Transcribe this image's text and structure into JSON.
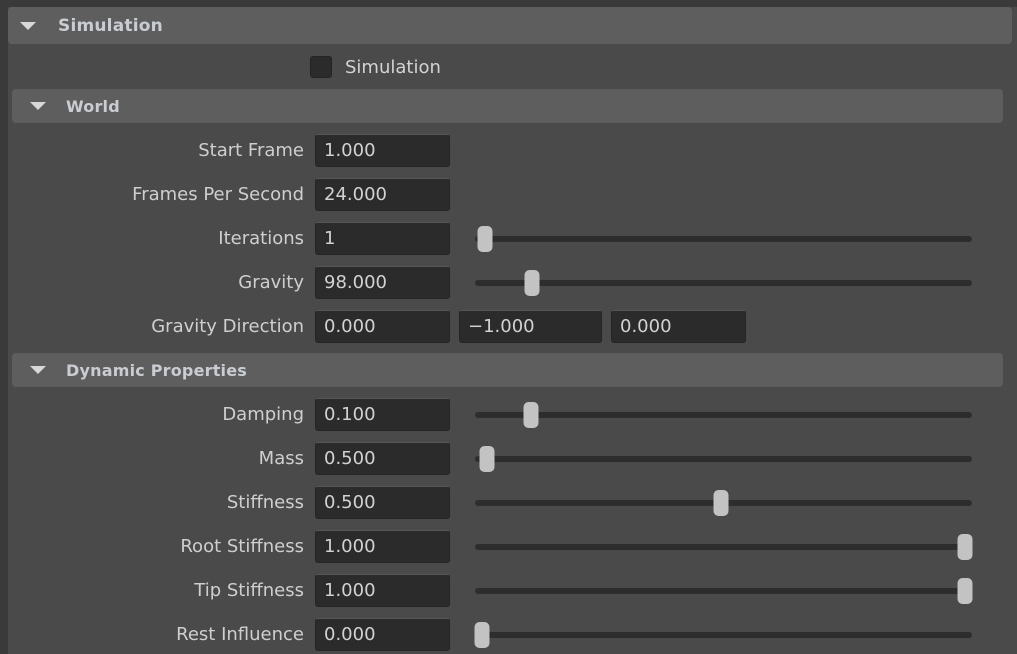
{
  "panel": {
    "title": "Simulation",
    "collapse_icon": "triangle-down-icon"
  },
  "enable_toggle": {
    "label": "Simulation",
    "checked": false,
    "checkbox_icon": "checkbox-unchecked-icon"
  },
  "sections": [
    {
      "id": "world",
      "title": "World",
      "collapse_icon": "triangle-down-icon",
      "rows": [
        {
          "label": "Start Frame",
          "value": "1.000",
          "has_slider": false
        },
        {
          "label": "Frames Per Second",
          "value": "24.000",
          "has_slider": false
        },
        {
          "label": "Iterations",
          "value": "1",
          "has_slider": true,
          "slider_percent": 2
        },
        {
          "label": "Gravity",
          "value": "98.000",
          "has_slider": true,
          "slider_percent": 11.5
        },
        {
          "label": "Gravity Direction",
          "value": "0.000",
          "has_slider": false,
          "vector": [
            "0.000",
            "−1.000",
            "0.000"
          ]
        }
      ]
    },
    {
      "id": "dynamic-properties",
      "title": "Dynamic Properties",
      "collapse_icon": "triangle-down-icon",
      "rows": [
        {
          "label": "Damping",
          "value": "0.100",
          "has_slider": true,
          "slider_percent": 11.2
        },
        {
          "label": "Mass",
          "value": "0.500",
          "has_slider": true,
          "slider_percent": 2.4
        },
        {
          "label": "Stiffness",
          "value": "0.500",
          "has_slider": true,
          "slider_percent": 49.5
        },
        {
          "label": "Root Stiffness",
          "value": "1.000",
          "has_slider": true,
          "slider_percent": 98.5
        },
        {
          "label": "Tip Stiffness",
          "value": "1.000",
          "has_slider": true,
          "slider_percent": 98.5
        },
        {
          "label": "Rest Influence",
          "value": "0.000",
          "has_slider": true,
          "slider_percent": 1.5
        }
      ]
    }
  ],
  "colors": {
    "background": "#4a4a4a",
    "header_bar": "#5e5e5e",
    "field_bg": "#2b2b2b",
    "track": "#2d2d2d",
    "knob": "#c3c3c3",
    "text": "#cfcfcf",
    "header_text": "#c9cdd2",
    "gutter": "#3a3a3a"
  }
}
